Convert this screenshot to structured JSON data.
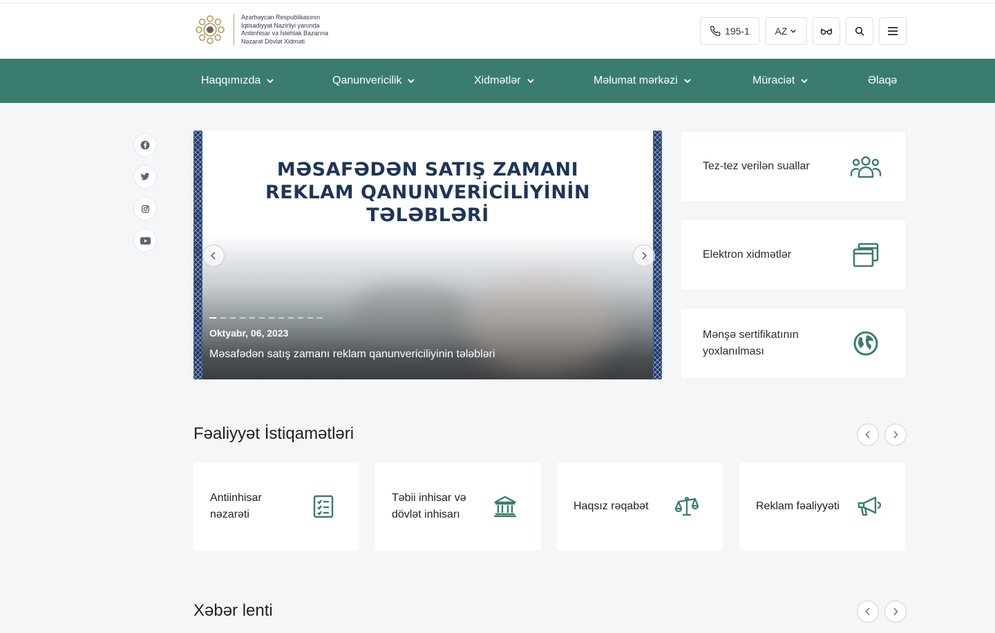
{
  "colors": {
    "brand_green": "#3a7c6e",
    "title_navy": "#1e3557",
    "ornament_blue": "#1f3a6e",
    "logo_gold": "#b59a5c"
  },
  "header": {
    "logo_icon": "state-emblem-logo",
    "logo_lines": [
      "Azərbaycan Respublikasının",
      "İqtisadiyyat Nazirliyi yanında",
      "Antiinhisar və İstehlak Bazarına",
      "Nəzarət Dövlət Xidməti"
    ],
    "phone_icon": "phone-icon",
    "phone": "195-1",
    "language": "AZ",
    "accessibility_icon": "glasses-icon",
    "search_icon": "search-icon",
    "menu_icon": "hamburger-menu-icon"
  },
  "nav": {
    "items": [
      {
        "label": "Haqqımızda",
        "has_dropdown": true
      },
      {
        "label": "Qanunvericilik",
        "has_dropdown": true
      },
      {
        "label": "Xidmətlər",
        "has_dropdown": true
      },
      {
        "label": "Məlumat mərkəzi",
        "has_dropdown": true
      },
      {
        "label": "Müraciət",
        "has_dropdown": true
      },
      {
        "label": "Əlaqə",
        "has_dropdown": false
      }
    ]
  },
  "social": [
    "facebook-icon",
    "twitter-icon",
    "instagram-icon",
    "youtube-icon"
  ],
  "slider": {
    "title_lines": [
      "MƏSAFƏDƏN SATIŞ ZAMANI",
      "REKLAM QANUNVERİCİLİYİNİN",
      "TƏLƏBLƏRİ"
    ],
    "date": "Oktyabr, 06, 2023",
    "caption": "Məsafədən satış zamanı reklam qanunvericiliyinin tələbləri",
    "slide_count": 12,
    "active_index": 0
  },
  "quick_links": [
    {
      "label": "Tez-tez verilən suallar",
      "icon": "people-group-icon"
    },
    {
      "label": "Elektron xidmətlər",
      "icon": "windows-icon"
    },
    {
      "label": "Mənşə sertifikatının yoxlanılması",
      "icon": "globe-icon"
    }
  ],
  "activities": {
    "title": "Fəaliyyət İstiqamətləri",
    "items": [
      {
        "label": "Antiinhisar nəzarəti",
        "icon": "checklist-icon"
      },
      {
        "label": "Təbii inhisar və dövlət inhisarı",
        "icon": "government-building-icon"
      },
      {
        "label": "Haqsız rəqabət",
        "icon": "scales-icon"
      },
      {
        "label": "Reklam fəaliyyəti",
        "icon": "megaphone-icon"
      }
    ]
  },
  "news": {
    "title": "Xəbər lenti"
  }
}
